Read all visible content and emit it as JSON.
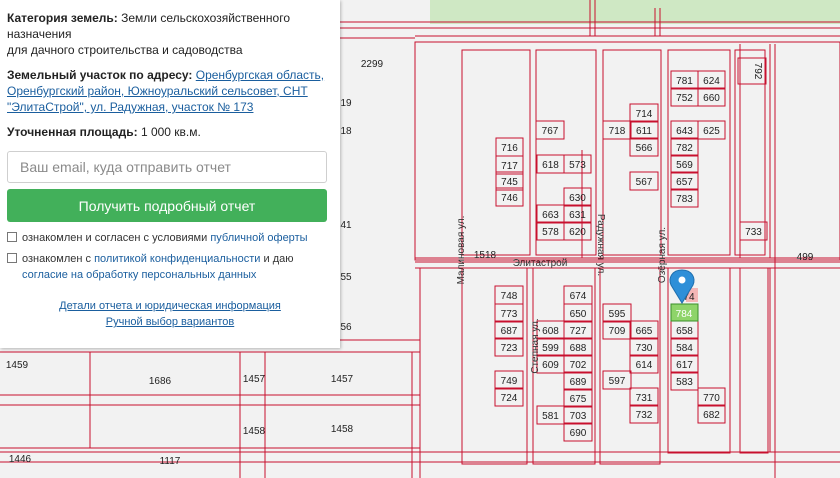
{
  "panel": {
    "category_label": "Категория земель:",
    "category_value": "Земли сельскохозяйственного назначения",
    "category_value2": "для дачного строительства и садоводства",
    "address_label": "Земельный участок по адресу:",
    "address_line1": "Оренбургская область,",
    "address_line2": "Оренбургский район, Южноуральский сельсовет, СНТ",
    "address_line3": "\"ЭлитаСтрой\", ул. Радужная, участок № 173",
    "area_label": "Уточненная площадь:",
    "area_value": "1 000 кв.м.",
    "email_placeholder": "Ваш email, куда отправить отчет",
    "button_label": "Получить подробный отчет",
    "check1_text": "ознакомлен и согласен с условиями",
    "check1_link": "публичной оферты",
    "check2_text": "ознакомлен с",
    "check2_link1": "политикой конфиденциальности",
    "check2_mid": "и даю",
    "check2_link2": "согласие на обработку персональных данных",
    "link_details": "Детали отчета и юридическая информация",
    "link_manual": "Ручной выбор вариантов"
  },
  "map": {
    "line_color": "#c8102e",
    "bg_color": "#f2f2f2",
    "highlight_color": "#8ed46a",
    "marker_color": "#2e8fd8",
    "street_labels": [
      "Малиновая ул.",
      "Степная ул.",
      "Радужная ул.",
      "Озёрная ул.",
      "Элитастрой"
    ],
    "selected_plot": "784",
    "plots": [
      "2299",
      "19",
      "18",
      "41",
      "55",
      "56",
      "1459",
      "1686",
      "1457",
      "1457",
      "1458",
      "1458",
      "1446",
      "1117",
      "1518",
      "716",
      "717",
      "745",
      "746",
      "748",
      "773",
      "687",
      "723",
      "749",
      "724",
      "767",
      "618",
      "573",
      "630",
      "663",
      "631",
      "578",
      "620",
      "674",
      "650",
      "608",
      "727",
      "599",
      "688",
      "609",
      "702",
      "689",
      "675",
      "581",
      "703",
      "690",
      "714",
      "718",
      "611",
      "566",
      "567",
      "595",
      "709",
      "665",
      "730",
      "614",
      "597",
      "731",
      "732",
      "781",
      "624",
      "752",
      "660",
      "643",
      "625",
      "782",
      "569",
      "657",
      "783",
      "584",
      "658",
      "617",
      "583",
      "770",
      "682",
      "733",
      "499",
      "792",
      "74"
    ]
  }
}
